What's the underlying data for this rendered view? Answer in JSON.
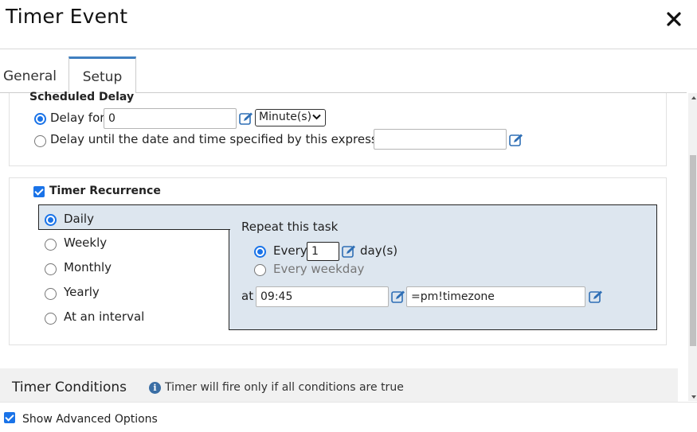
{
  "dialog": {
    "title": "Timer Event",
    "close_icon": "close-icon"
  },
  "tabs": [
    {
      "label": "General",
      "active": false
    },
    {
      "label": "Setup",
      "active": true
    }
  ],
  "scheduled_delay": {
    "heading": "Scheduled Delay",
    "delay_for_label": "Delay for",
    "delay_for_value": "0",
    "delay_for_selected": true,
    "unit_selected": "Minute(s)",
    "delay_until_label": "Delay until the date and time specified by this expression:",
    "delay_until_value": "",
    "delay_until_selected": false
  },
  "recurrence": {
    "checkbox_label": "Timer Recurrence",
    "checked": true,
    "options": [
      {
        "label": "Daily",
        "selected": true
      },
      {
        "label": "Weekly",
        "selected": false
      },
      {
        "label": "Monthly",
        "selected": false
      },
      {
        "label": "Yearly",
        "selected": false
      },
      {
        "label": "At an interval",
        "selected": false
      }
    ],
    "daily": {
      "heading": "Repeat this task",
      "every_label": "Every",
      "every_value": "1",
      "every_unit": "day(s)",
      "every_selected": true,
      "weekday_label": "Every weekday",
      "weekday_selected": false,
      "at_label": "at",
      "time_value": "09:45",
      "timezone_value": "=pm!timezone"
    }
  },
  "conditions": {
    "heading": "Timer Conditions",
    "info_text": "Timer will fire only if all conditions are true"
  },
  "footer": {
    "advanced_label": "Show Advanced Options",
    "advanced_checked": true
  },
  "colors": {
    "accent": "#1a73e8",
    "tab_accent": "#3f7fc0",
    "panel_bg": "#dde6ef",
    "edit_icon": "#2f6fb5"
  }
}
